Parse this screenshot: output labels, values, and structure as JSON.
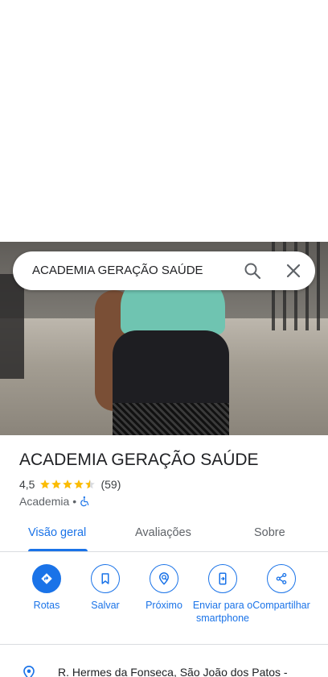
{
  "search": {
    "query": "ACADEMIA GERAÇÃO SAÚDE"
  },
  "place": {
    "title": "ACADEMIA GERAÇÃO SAÚDE",
    "rating": "4,5",
    "stars": 4.5,
    "reviews_count": "(59)",
    "category": "Academia",
    "separator": "•"
  },
  "tabs": [
    {
      "label": "Visão geral",
      "active": true
    },
    {
      "label": "Avaliações",
      "active": false
    },
    {
      "label": "Sobre",
      "active": false
    }
  ],
  "actions": [
    {
      "label": "Rotas",
      "icon": "directions-icon"
    },
    {
      "label": "Salvar",
      "icon": "bookmark-icon"
    },
    {
      "label": "Próximo",
      "icon": "nearby-icon"
    },
    {
      "label": "Enviar para o smartphone",
      "icon": "send-to-phone-icon"
    },
    {
      "label": "Compartilhar",
      "icon": "share-icon"
    }
  ],
  "address": {
    "text": "R. Hermes da Fonseca, São João dos Patos -"
  },
  "colors": {
    "accent": "#1a73e8",
    "star": "#fbbc04",
    "text": "#202124",
    "secondary": "#5f6368"
  }
}
